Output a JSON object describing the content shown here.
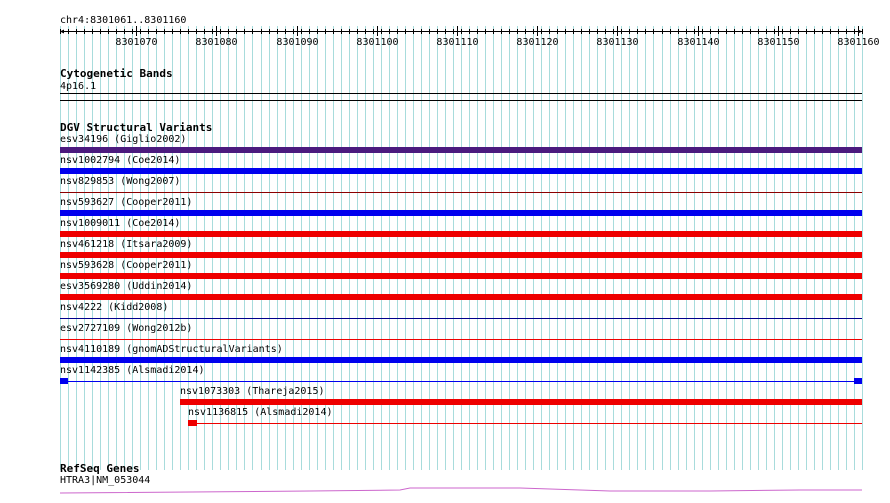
{
  "ruler": {
    "location": "chr4:8301061..8301160",
    "ticks": [
      "8301070",
      "8301080",
      "8301090",
      "8301100",
      "8301110",
      "8301120",
      "8301130",
      "8301140",
      "8301150",
      "8301160"
    ]
  },
  "cytoband": {
    "title": "Cytogenetic Bands",
    "label": "4p16.1"
  },
  "dgv": {
    "title": "DGV Structural Variants",
    "features": [
      {
        "id": "esv34196",
        "label": "esv34196 (Giglio2002)",
        "color": "#4b1a7e",
        "start": 8301061,
        "end": 8301160,
        "style": "bar"
      },
      {
        "id": "nsv1002794",
        "label": "nsv1002794 (Coe2014)",
        "color": "#0000ee",
        "start": 8301061,
        "end": 8301160,
        "style": "bar"
      },
      {
        "id": "nsv829853",
        "label": "nsv829853 (Wong2007)",
        "color": "#8b0000",
        "start": 8301061,
        "end": 8301160,
        "style": "thin"
      },
      {
        "id": "nsv593627",
        "label": "nsv593627 (Cooper2011)",
        "color": "#0000ee",
        "start": 8301061,
        "end": 8301160,
        "style": "bar"
      },
      {
        "id": "nsv1009011",
        "label": "nsv1009011 (Coe2014)",
        "color": "#ee0000",
        "start": 8301061,
        "end": 8301160,
        "style": "bar"
      },
      {
        "id": "nsv461218",
        "label": "nsv461218 (Itsara2009)",
        "color": "#ee0000",
        "start": 8301061,
        "end": 8301160,
        "style": "bar"
      },
      {
        "id": "nsv593628",
        "label": "nsv593628 (Cooper2011)",
        "color": "#ee0000",
        "start": 8301061,
        "end": 8301160,
        "style": "bar"
      },
      {
        "id": "esv3569280",
        "label": "esv3569280 (Uddin2014)",
        "color": "#ee0000",
        "start": 8301061,
        "end": 8301160,
        "style": "bar"
      },
      {
        "id": "nsv4222",
        "label": "nsv4222 (Kidd2008)",
        "color": "#00008b",
        "start": 8301061,
        "end": 8301160,
        "style": "thin"
      },
      {
        "id": "esv2727109",
        "label": "esv2727109 (Wong2012b)",
        "color": "#ee0000",
        "start": 8301061,
        "end": 8301160,
        "style": "thin"
      },
      {
        "id": "nsv4110189",
        "label": "nsv4110189 (gnomADStructuralVariants)",
        "color": "#0000ee",
        "start": 8301061,
        "end": 8301160,
        "style": "bar"
      },
      {
        "id": "nsv1142385",
        "label": "nsv1142385 (Alsmadi2014)",
        "color": "#0000ee",
        "start": 8301061,
        "end": 8301160,
        "style": "split"
      },
      {
        "id": "nsv1073303",
        "label": "nsv1073303 (Thareja2015)",
        "color": "#ee0000",
        "start": 8301076,
        "end": 8301160,
        "style": "bar"
      },
      {
        "id": "nsv1136815",
        "label": "nsv1136815 (Alsmadi2014)",
        "color": "#ee0000",
        "start": 8301077,
        "end": 8301160,
        "style": "splitleft"
      }
    ]
  },
  "refseq": {
    "title": "RefSeq Genes",
    "label": "HTRA3|NM_053044",
    "color": "#cc66cc"
  }
}
